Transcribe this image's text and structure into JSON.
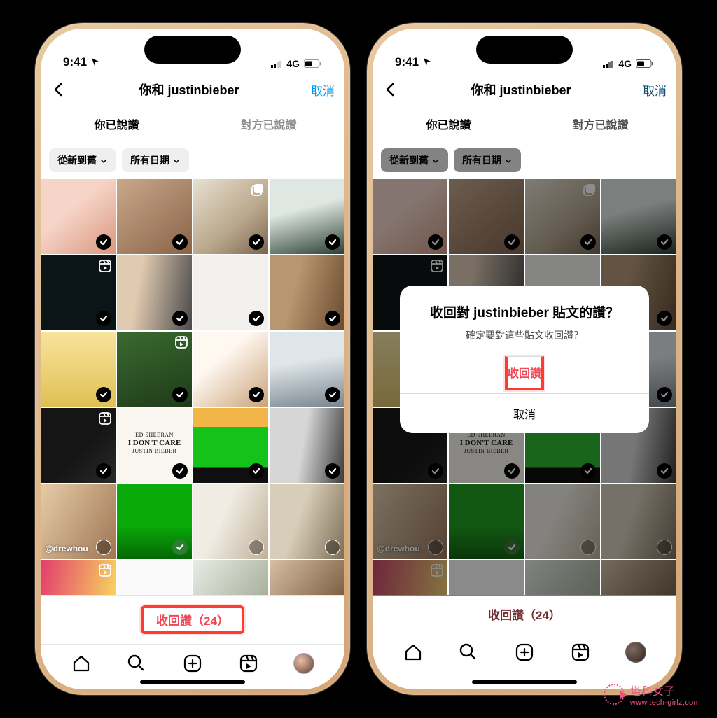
{
  "status": {
    "time": "9:41",
    "network": "4G"
  },
  "header": {
    "title": "你和 justinbieber",
    "cancel": "取消"
  },
  "tabs": {
    "you_liked": "你已說讚",
    "they_liked": "對方已說讚"
  },
  "filters": {
    "sort": "從新到舊",
    "dates": "所有日期"
  },
  "tiles": [
    {
      "checked": true
    },
    {
      "checked": true
    },
    {
      "checked": true,
      "multi": true
    },
    {
      "checked": true
    },
    {
      "checked": true,
      "reel": true
    },
    {
      "checked": true
    },
    {
      "checked": true,
      "text_post": true
    },
    {
      "checked": true
    },
    {
      "checked": true
    },
    {
      "checked": true,
      "reel": true
    },
    {
      "checked": true
    },
    {
      "checked": true
    },
    {
      "checked": true,
      "reel": true
    },
    {
      "checked": true,
      "album": true
    },
    {
      "checked": true
    },
    {
      "checked": true
    },
    {
      "checked": false,
      "tag": "@drewhou"
    },
    {
      "checked": true,
      "green": true
    },
    {
      "checked": false
    },
    {
      "checked": false
    },
    {
      "partial": true,
      "reel": true
    },
    {
      "partial": true
    },
    {
      "partial": true
    },
    {
      "partial": true
    }
  ],
  "album": {
    "line1": "ED SHEERAN",
    "line2": "I DON'T CARE",
    "line3": "JUSTIN BIEBER"
  },
  "unlike_button": "收回讚（24）",
  "dialog": {
    "title": "收回對 justinbieber 貼文的讚？",
    "message": "確定要對這些貼文收回讚？",
    "confirm": "收回讚",
    "cancel": "取消"
  },
  "watermark": {
    "name": "塔科女子",
    "url": "www.tech-girlz.com"
  }
}
